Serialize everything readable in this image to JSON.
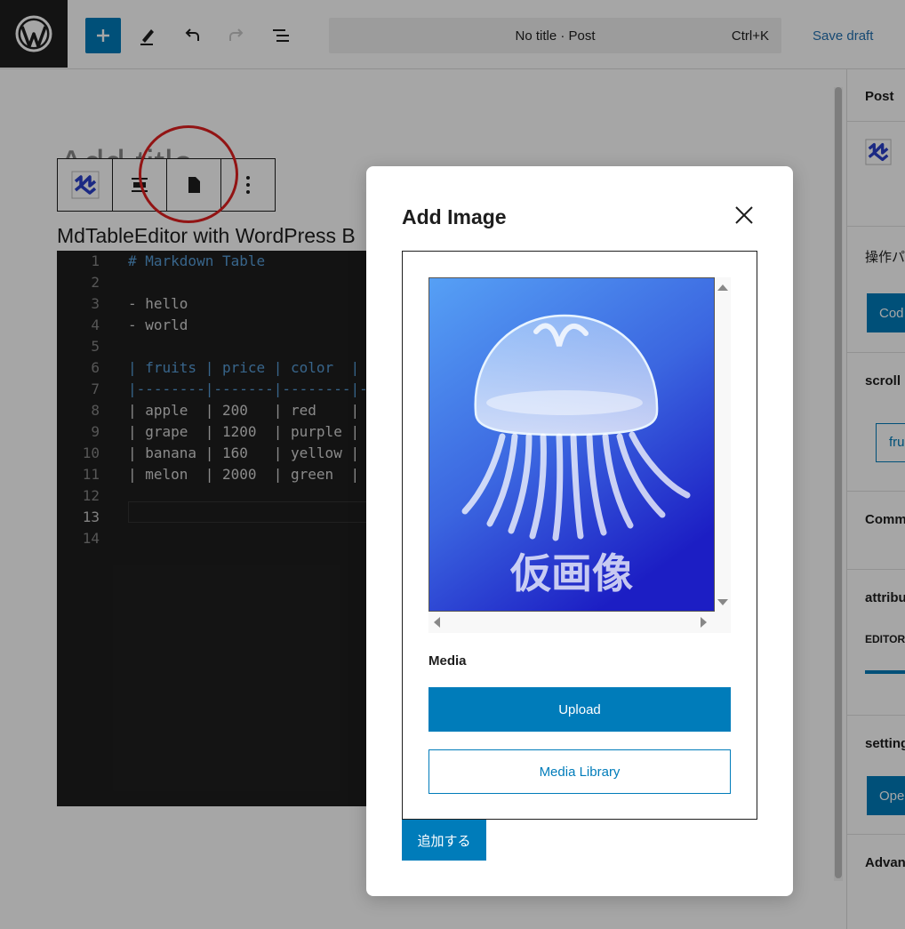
{
  "topbar": {
    "command_title": "No title · Post",
    "command_shortcut": "Ctrl+K",
    "save_draft": "Save draft"
  },
  "canvas": {
    "title_placeholder": "Add title",
    "block_label": "MdTableEditor with WordPress B",
    "code_lines": [
      {
        "num": "1",
        "text": "# Markdown Table",
        "color": "#569cd6"
      },
      {
        "num": "2",
        "text": "",
        "color": "#d4d4d4"
      },
      {
        "num": "3",
        "text": "- hello",
        "color": "#d4d4d4"
      },
      {
        "num": "4",
        "text": "- world",
        "color": "#d4d4d4"
      },
      {
        "num": "5",
        "text": "",
        "color": "#d4d4d4"
      },
      {
        "num": "6",
        "text": "| fruits | price | color  |",
        "color": "#569cd6"
      },
      {
        "num": "7",
        "text": "|--------|-------|--------|-",
        "color": "#569cd6"
      },
      {
        "num": "8",
        "text": "| apple  | 200   | red    |",
        "color": "#d4d4d4"
      },
      {
        "num": "9",
        "text": "| grape  | 1200  | purple |",
        "color": "#d4d4d4"
      },
      {
        "num": "10",
        "text": "| banana | 160   | yellow |",
        "color": "#d4d4d4"
      },
      {
        "num": "11",
        "text": "| melon  | 2000  | green  |",
        "color": "#d4d4d4"
      },
      {
        "num": "12",
        "text": "",
        "color": "#d4d4d4"
      },
      {
        "num": "13",
        "text": "",
        "color": "#d4d4d4"
      },
      {
        "num": "14",
        "text": "",
        "color": "#d4d4d4"
      }
    ],
    "active_line": "13"
  },
  "sidebar": {
    "tab_post": "Post",
    "section_ops": "操作パ",
    "ops_button": "Cod",
    "section_scroll": "scroll",
    "scroll_chip": "fru",
    "section_comm": "Comm",
    "section_attr": "attribu",
    "attr_label": "EDITOR",
    "section_settings": "setting",
    "settings_button": "Ope",
    "section_advanced": "Advan"
  },
  "modal": {
    "title": "Add Image",
    "image_caption": "仮画像",
    "media_label": "Media",
    "upload_button": "Upload",
    "library_button": "Media Library",
    "add_button": "追加する"
  },
  "colors": {
    "accent": "#007cba",
    "annotation": "#e02020",
    "editor_bg": "#1e1e1e"
  },
  "icons": {
    "logo": "wordpress-logo-icon",
    "add": "plus-icon",
    "tools": "pencil-icon",
    "undo": "undo-icon",
    "redo": "redo-icon",
    "outline": "list-view-icon",
    "block": "markdown-block-icon",
    "align": "align-icon",
    "file": "file-icon",
    "more": "more-vertical-icon",
    "close": "close-icon"
  }
}
